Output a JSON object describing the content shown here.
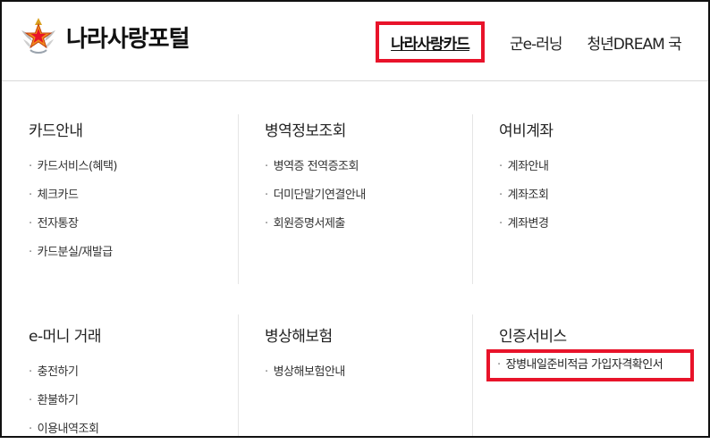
{
  "brand": {
    "name": "나라사랑포털"
  },
  "nav": {
    "active": "나라사랑카드",
    "items": [
      "군e-러닝",
      "청년DREAM 국"
    ]
  },
  "sections": [
    {
      "title": "카드안내",
      "links": [
        "카드서비스(혜택)",
        "체크카드",
        "전자통장",
        "카드분실/재발급"
      ]
    },
    {
      "title": "병역정보조회",
      "links": [
        "병역증 전역증조회",
        "더미단말기연결안내",
        "회원증명서제출"
      ]
    },
    {
      "title": "여비계좌",
      "links": [
        "계좌안내",
        "계좌조회",
        "계좌변경"
      ]
    },
    {
      "title": "e-머니 거래",
      "links": [
        "충전하기",
        "환불하기",
        "이용내역조회"
      ]
    },
    {
      "title": "병상해보험",
      "links": [
        "병상해보험안내"
      ]
    },
    {
      "title": "인증서비스",
      "links": [
        "장병내일준비적금 가입자격확인서"
      ]
    }
  ],
  "bullet": "·",
  "colors": {
    "highlight": "#e8132a"
  },
  "icons": {
    "logo": "military-emblem-star-icon"
  }
}
